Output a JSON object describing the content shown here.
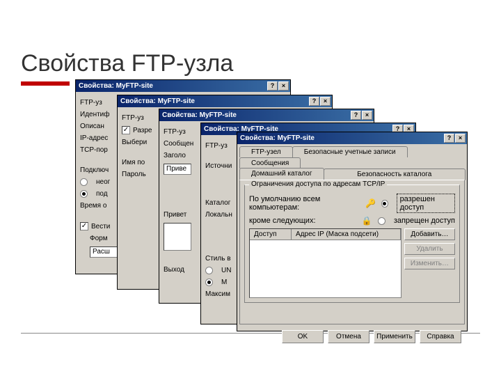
{
  "slide": {
    "title": "Свойства FTP-узла"
  },
  "dialog_title": "Свойства: MyFTP-site",
  "sysbtn": {
    "help": "?",
    "close": "×"
  },
  "back_labels": {
    "ftp_node": "FTP-уз",
    "identification": "Идентиф",
    "description": "Описан",
    "ip_address": "IP-адрес",
    "tcp_port": "TCP-пор",
    "connections": "Подключ",
    "unlimited": "неог",
    "limited": "под",
    "timeout": "Время о",
    "keep_log": "Вести",
    "format": "Форм",
    "extension": "Расш"
  },
  "w2_labels": {
    "allow_anon": "Разре",
    "select": "Выбери",
    "username": "Имя по",
    "password": "Пароль"
  },
  "w3_labels": {
    "messages": "Сообщен",
    "header": "Заголо",
    "greeting": "Привет",
    "hello_sample": "Приве",
    "output": "Выход"
  },
  "w4_labels": {
    "source": "Источни",
    "catalog": "Каталог",
    "local": "Локальн",
    "style": "Стиль в",
    "unix": "UN",
    "msdos": "M",
    "max": "Максим"
  },
  "tabs": {
    "ftp_node": "FTP-узел",
    "secure_accounts": "Безопасные учетные записи",
    "messages": "Сообщения",
    "home_directory": "Домашний каталог",
    "directory_security": "Безопасность каталога"
  },
  "panel": {
    "group_title": "Ограничения доступа по адресам TCP/IP",
    "default_label": "По умолчанию всем компьютерам:",
    "allow": "разрешен доступ",
    "deny": "запрещен доступ",
    "except_label": "кроме  следующих:",
    "col_access": "Доступ",
    "col_ip": "Адрес IP (Маска подсети)",
    "add": "Добавить…",
    "remove": "Удалить",
    "change": "Изменить…"
  },
  "buttons": {
    "ok": "OK",
    "cancel": "Отмена",
    "apply": "Применить",
    "help": "Справка"
  }
}
